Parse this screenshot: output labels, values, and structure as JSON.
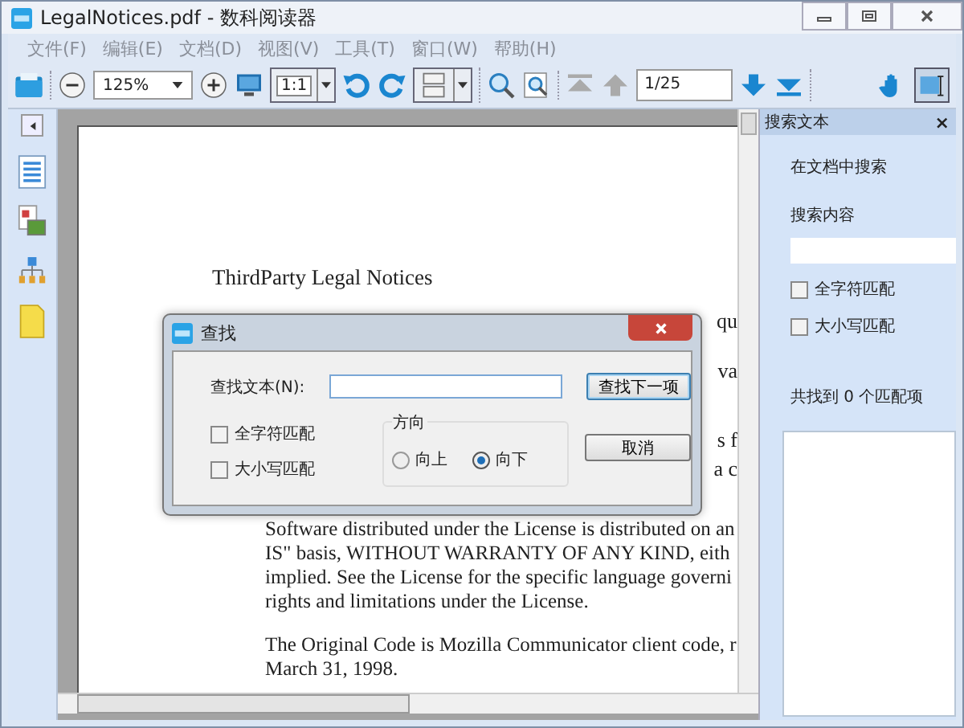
{
  "window": {
    "title": "LegalNotices.pdf - 数科阅读器"
  },
  "menu": [
    "文件(F)",
    "编辑(E)",
    "文档(D)",
    "视图(V)",
    "工具(T)",
    "窗口(W)",
    "帮助(H)"
  ],
  "toolbar": {
    "zoom": "125%",
    "fit": "1:1",
    "page": "1/25"
  },
  "document": {
    "heading": "ThirdParty Legal Notices",
    "fragments": [
      "qu",
      "va",
      "s f",
      "a c"
    ],
    "paragraphs": [
      [
        "Software distributed under the License is distributed on an",
        "IS\" basis, WITHOUT WARRANTY OF ANY KIND, eith",
        "implied. See the License for the specific language governi",
        "rights and limitations under the License."
      ],
      [
        "The Original Code is Mozilla Communicator client code, r",
        "March 31, 1998."
      ]
    ]
  },
  "dialog": {
    "title": "查找",
    "find_label": "查找文本(N):",
    "find_next": "查找下一项",
    "cancel": "取消",
    "options": [
      {
        "label": "全字符匹配",
        "checked": false
      },
      {
        "label": "大小写匹配",
        "checked": false
      }
    ],
    "direction": {
      "label": "方向",
      "options": [
        {
          "label": "向上",
          "selected": false
        },
        {
          "label": "向下",
          "selected": true
        }
      ]
    }
  },
  "panel": {
    "title": "搜索文本",
    "close": "×",
    "subtitle": "在文档中搜索",
    "field_label": "搜索内容",
    "options": [
      {
        "label": "全字符匹配",
        "checked": false
      },
      {
        "label": "大小写匹配",
        "checked": false
      }
    ],
    "result": "共找到 0 个匹配项"
  }
}
